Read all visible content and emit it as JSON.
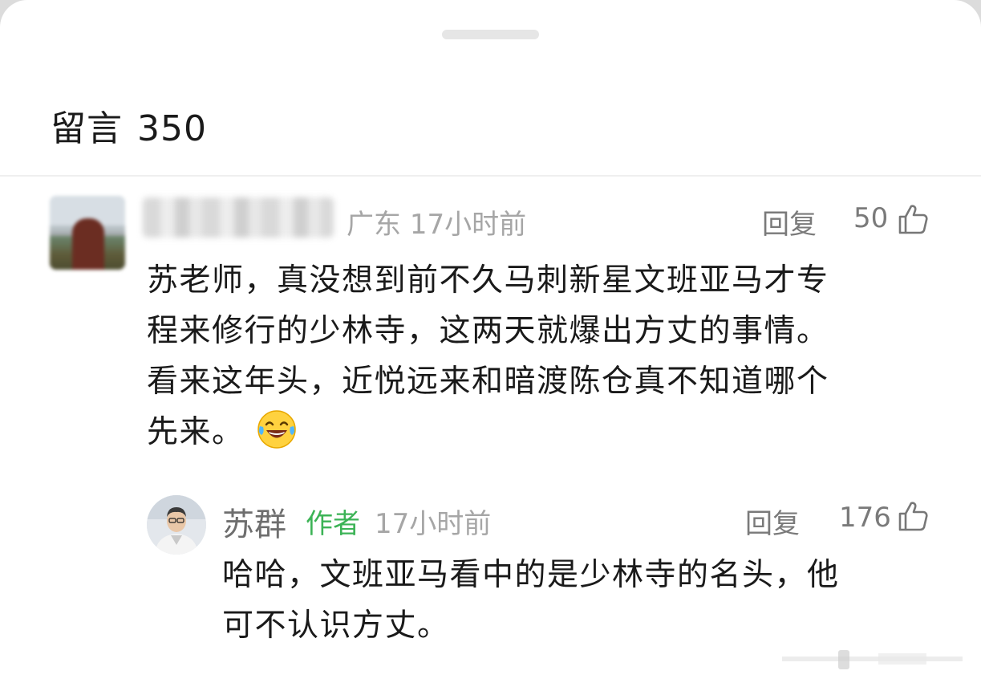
{
  "header": {
    "title": "留言",
    "count": "350"
  },
  "comments": [
    {
      "location": "广东",
      "time": "17小时前",
      "reply_label": "回复",
      "likes": "50",
      "text_lines": [
        "苏老师，真没想到前不久马刺新星文班亚马才专",
        "程来修行的少林寺，这两天就爆出方丈的事情。",
        "看来这年头，近悦远来和暗渡陈仓真不知道哪个",
        "先来。"
      ],
      "emoji": "laughing-tears-emoji",
      "reply": {
        "name": "苏群",
        "badge": "作者",
        "time": "17小时前",
        "reply_label": "回复",
        "likes": "176",
        "text_lines": [
          "哈哈，文班亚马看中的是少林寺的名头，他",
          "可不认识方丈。"
        ]
      }
    }
  ],
  "icons": {
    "like": "thumbs-up-icon"
  },
  "colors": {
    "author_badge": "#3cb356",
    "meta_text": "#a6a6a6",
    "body_text": "#1a1a1a"
  }
}
